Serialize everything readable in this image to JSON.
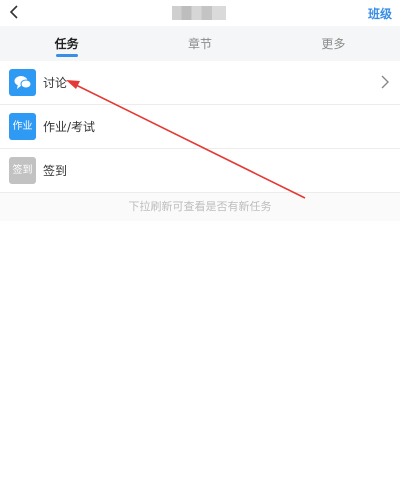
{
  "header": {
    "class_link": "班级"
  },
  "tabs": [
    {
      "label": "任务",
      "active": true
    },
    {
      "label": "章节",
      "active": false
    },
    {
      "label": "更多",
      "active": false
    }
  ],
  "tasks": [
    {
      "label": "讨论",
      "icon": "chat-bubble-icon",
      "icon_color": "#2f9af3",
      "icon_text": ""
    },
    {
      "label": "作业/考试",
      "icon": "homework-icon",
      "icon_color": "#2f9af3",
      "icon_text": "作业"
    },
    {
      "label": "签到",
      "icon": "checkin-icon",
      "icon_color": "#c2c2c2",
      "icon_text": "签到"
    }
  ],
  "hint": "下拉刷新可查看是否有新任务",
  "colors": {
    "accent": "#3a8ee6",
    "arrow": "#e53935"
  }
}
